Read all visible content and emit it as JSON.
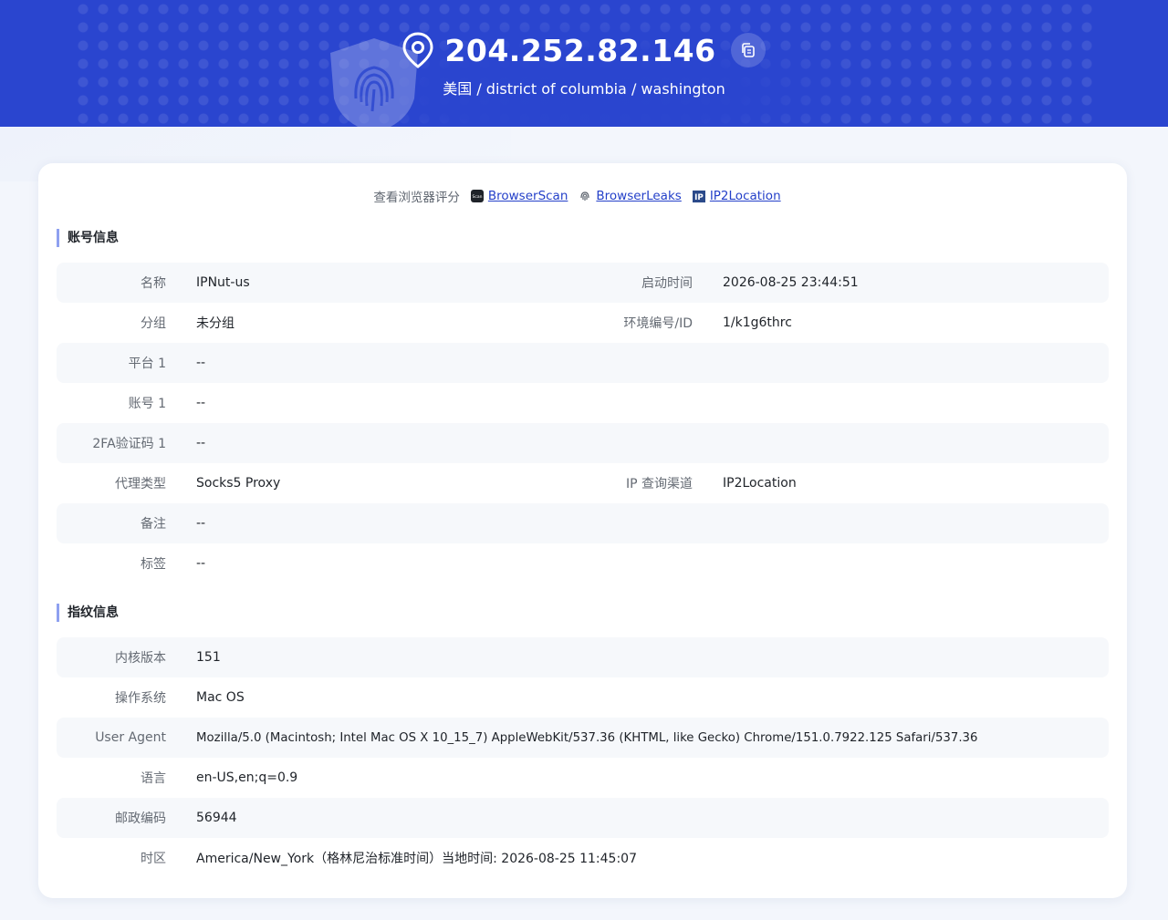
{
  "header": {
    "ip": "204.252.82.146",
    "location": "美国 / district of columbia / washington"
  },
  "scores": {
    "label": "查看浏览器评分",
    "links": [
      {
        "label": "BrowserScan",
        "icon": "browserscan-icon"
      },
      {
        "label": "BrowserLeaks",
        "icon": "fingerprint-icon"
      },
      {
        "label": "IP2Location",
        "icon": "ip2location-icon"
      }
    ]
  },
  "account": {
    "title": "账号信息",
    "rows": [
      {
        "k": "名称",
        "v": "IPNut-us",
        "k2": "启动时间",
        "v2": "2026-08-25 23:44:51"
      },
      {
        "k": "分组",
        "v": "未分组",
        "k2": "环境编号/ID",
        "v2": "1/k1g6thrc"
      },
      {
        "k": "平台 1",
        "v": "--"
      },
      {
        "k": "账号 1",
        "v": "--"
      },
      {
        "k": "2FA验证码 1",
        "v": "--"
      },
      {
        "k": "代理类型",
        "v": "Socks5 Proxy",
        "k2": "IP 查询渠道",
        "v2": "IP2Location"
      },
      {
        "k": "备注",
        "v": "--"
      },
      {
        "k": "标签",
        "v": "--"
      }
    ]
  },
  "fingerprint": {
    "title": "指纹信息",
    "rows": [
      {
        "k": "内核版本",
        "v": "151"
      },
      {
        "k": "操作系统",
        "v": "Mac OS"
      },
      {
        "k": "User Agent",
        "v": "Mozilla/5.0 (Macintosh; Intel Mac OS X 10_15_7) AppleWebKit/537.36 (KHTML, like Gecko) Chrome/151.0.7922.125 Safari/537.36"
      },
      {
        "k": "语言",
        "v": "en-US,en;q=0.9"
      },
      {
        "k": "邮政编码",
        "v": "56944"
      },
      {
        "k": "时区",
        "v": "America/New_York（格林尼治标准时间）当地时间: 2026-08-25 11:45:07"
      }
    ]
  },
  "colors": {
    "header_bg": "#2a45cf",
    "accent": "#2440c9",
    "section_bar": "#8ea0f0"
  }
}
